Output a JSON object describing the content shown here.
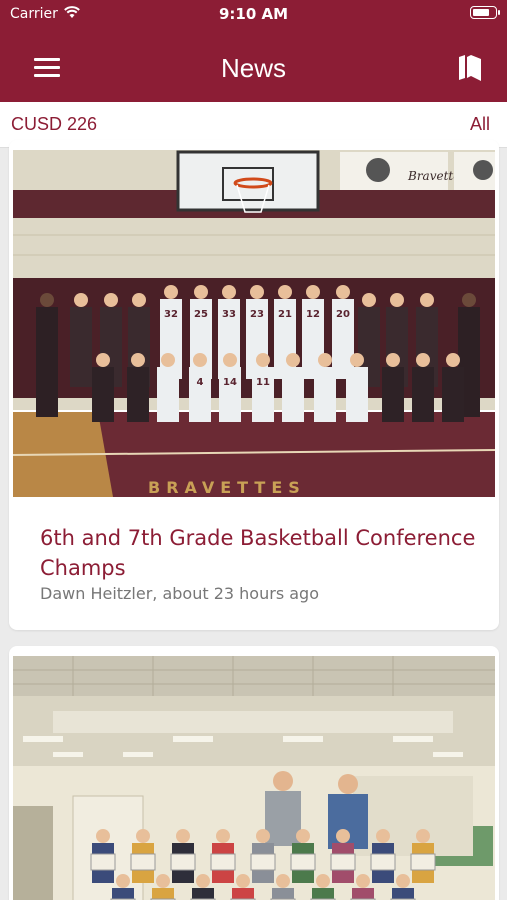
{
  "status_bar": {
    "carrier": "Carrier",
    "time": "9:10 AM",
    "battery_level": 0.8
  },
  "nav": {
    "title": "News",
    "left_icon": "hamburger-menu-icon",
    "right_icon": "book-icon"
  },
  "filter": {
    "district": "CUSD 226",
    "option": "All"
  },
  "news": [
    {
      "title": "6th and 7th Grade Basketball Conference Champs",
      "author": "Dawn Heitzler",
      "separator": ", ",
      "time_ago": "about 23 hours ago",
      "photo_banner_text": "BRAVETTES",
      "photo_pennant_text": "Bravettes",
      "jersey_numbers": [
        "32",
        "25",
        "33",
        "23",
        "21",
        "12",
        "20",
        "4",
        "14",
        "11"
      ]
    },
    {
      "photo_description_icon": "group-photo-icon"
    }
  ],
  "colors": {
    "brand": "#8c1d35",
    "background": "#ebebeb",
    "byline": "#777777"
  }
}
